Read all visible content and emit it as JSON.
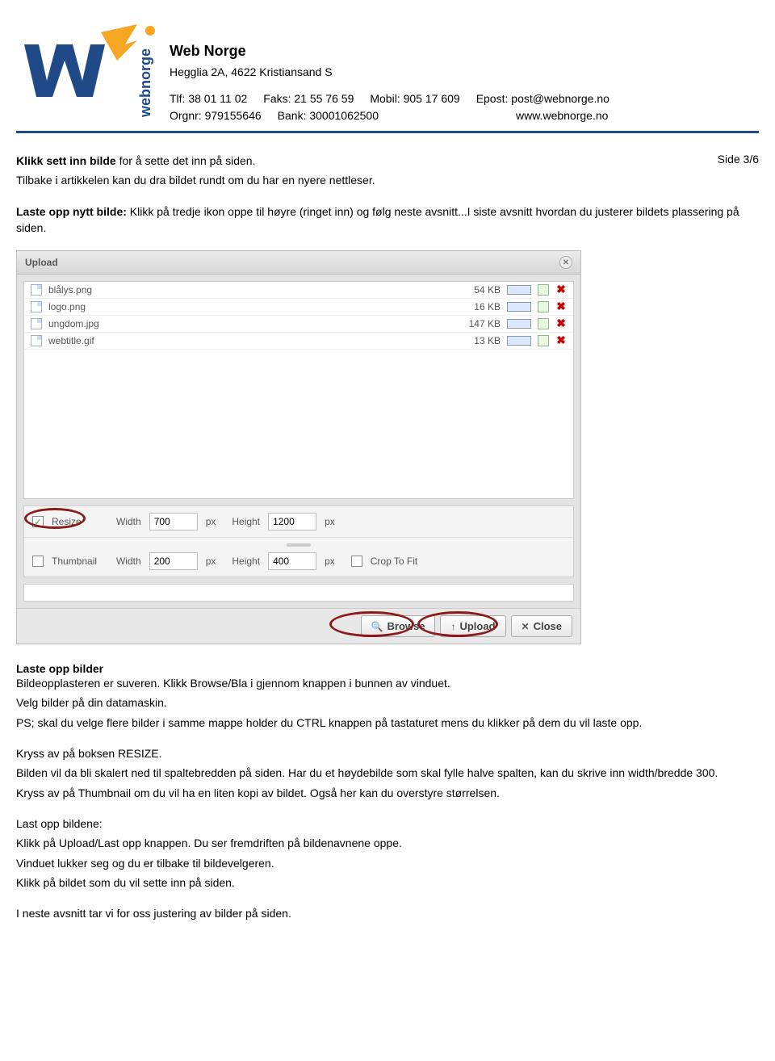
{
  "company": {
    "name": "Web Norge",
    "address": "Hegglia 2A, 4622 Kristiansand S",
    "tlf_label": "Tlf:",
    "tlf": "38 01 11 02",
    "faks_label": "Faks:",
    "faks": "21 55 76 59",
    "mobil_label": "Mobil:",
    "mobil": "905 17 609",
    "epost_label": "Epost:",
    "epost": "post@webnorge.no",
    "orgnr_label": "Orgnr:",
    "orgnr": "979155646",
    "bank_label": "Bank:",
    "bank": "30001062500",
    "web": "www.webnorge.no"
  },
  "page_number": "Side 3/6",
  "intro": {
    "l1a": "Klikk sett inn bilde",
    "l1b": " for å sette det inn på siden.",
    "l2": "Tilbake i artikkelen kan du dra bildet rundt om du har en nyere nettleser.",
    "l3a": "Laste opp nytt bilde:",
    "l3b": " Klikk på tredje ikon oppe til høyre (ringet inn) og følg neste avsnitt...I siste avsnitt hvordan du justerer bildets plassering på siden."
  },
  "upload_window": {
    "title": "Upload",
    "files": [
      {
        "name": "blålys.png",
        "size": "54 KB"
      },
      {
        "name": "logo.png",
        "size": "16 KB"
      },
      {
        "name": "ungdom.jpg",
        "size": "147 KB"
      },
      {
        "name": "webtitle.gif",
        "size": "13 KB"
      }
    ],
    "resize": {
      "checked": true,
      "label": "Resize",
      "width_label": "Width",
      "width": "700",
      "px": "px",
      "height_label": "Height",
      "height": "1200"
    },
    "thumb": {
      "checked": false,
      "label": "Thumbnail",
      "width_label": "Width",
      "width": "200",
      "px": "px",
      "height_label": "Height",
      "height": "400",
      "crop_label": "Crop To Fit",
      "crop_checked": false
    },
    "buttons": {
      "browse": "Browse",
      "upload": "Upload",
      "close": "Close"
    }
  },
  "after": {
    "t1": "Laste opp bilder",
    "p1": "Bildeopplasteren er suveren. Klikk Browse/Bla i gjennom knappen i bunnen av vinduet.",
    "p2": "Velg bilder på din datamaskin.",
    "p3": "PS; skal du velge flere bilder i samme mappe holder du CTRL knappen på tastaturet mens du klikker på dem du vil laste opp.",
    "p4": "Kryss av på boksen RESIZE.",
    "p5": "Bilden vil da bli skalert ned til spaltebredden på siden. Har du et høydebilde som skal fylle halve spalten, kan du skrive inn width/bredde 300.",
    "p6": "Kryss av på Thumbnail om du vil ha en liten kopi av bildet. Også her kan du overstyre størrelsen.",
    "p7": "Last opp bildene:",
    "p8": "Klikk på Upload/Last opp knappen. Du ser fremdriften på bildenavnene oppe.",
    "p9": "Vinduet lukker seg og du er tilbake til bildevelgeren.",
    "p10": "Klikk på bildet som du vil sette inn på siden.",
    "p11": "I neste avsnitt tar vi for oss justering av bilder på siden."
  }
}
